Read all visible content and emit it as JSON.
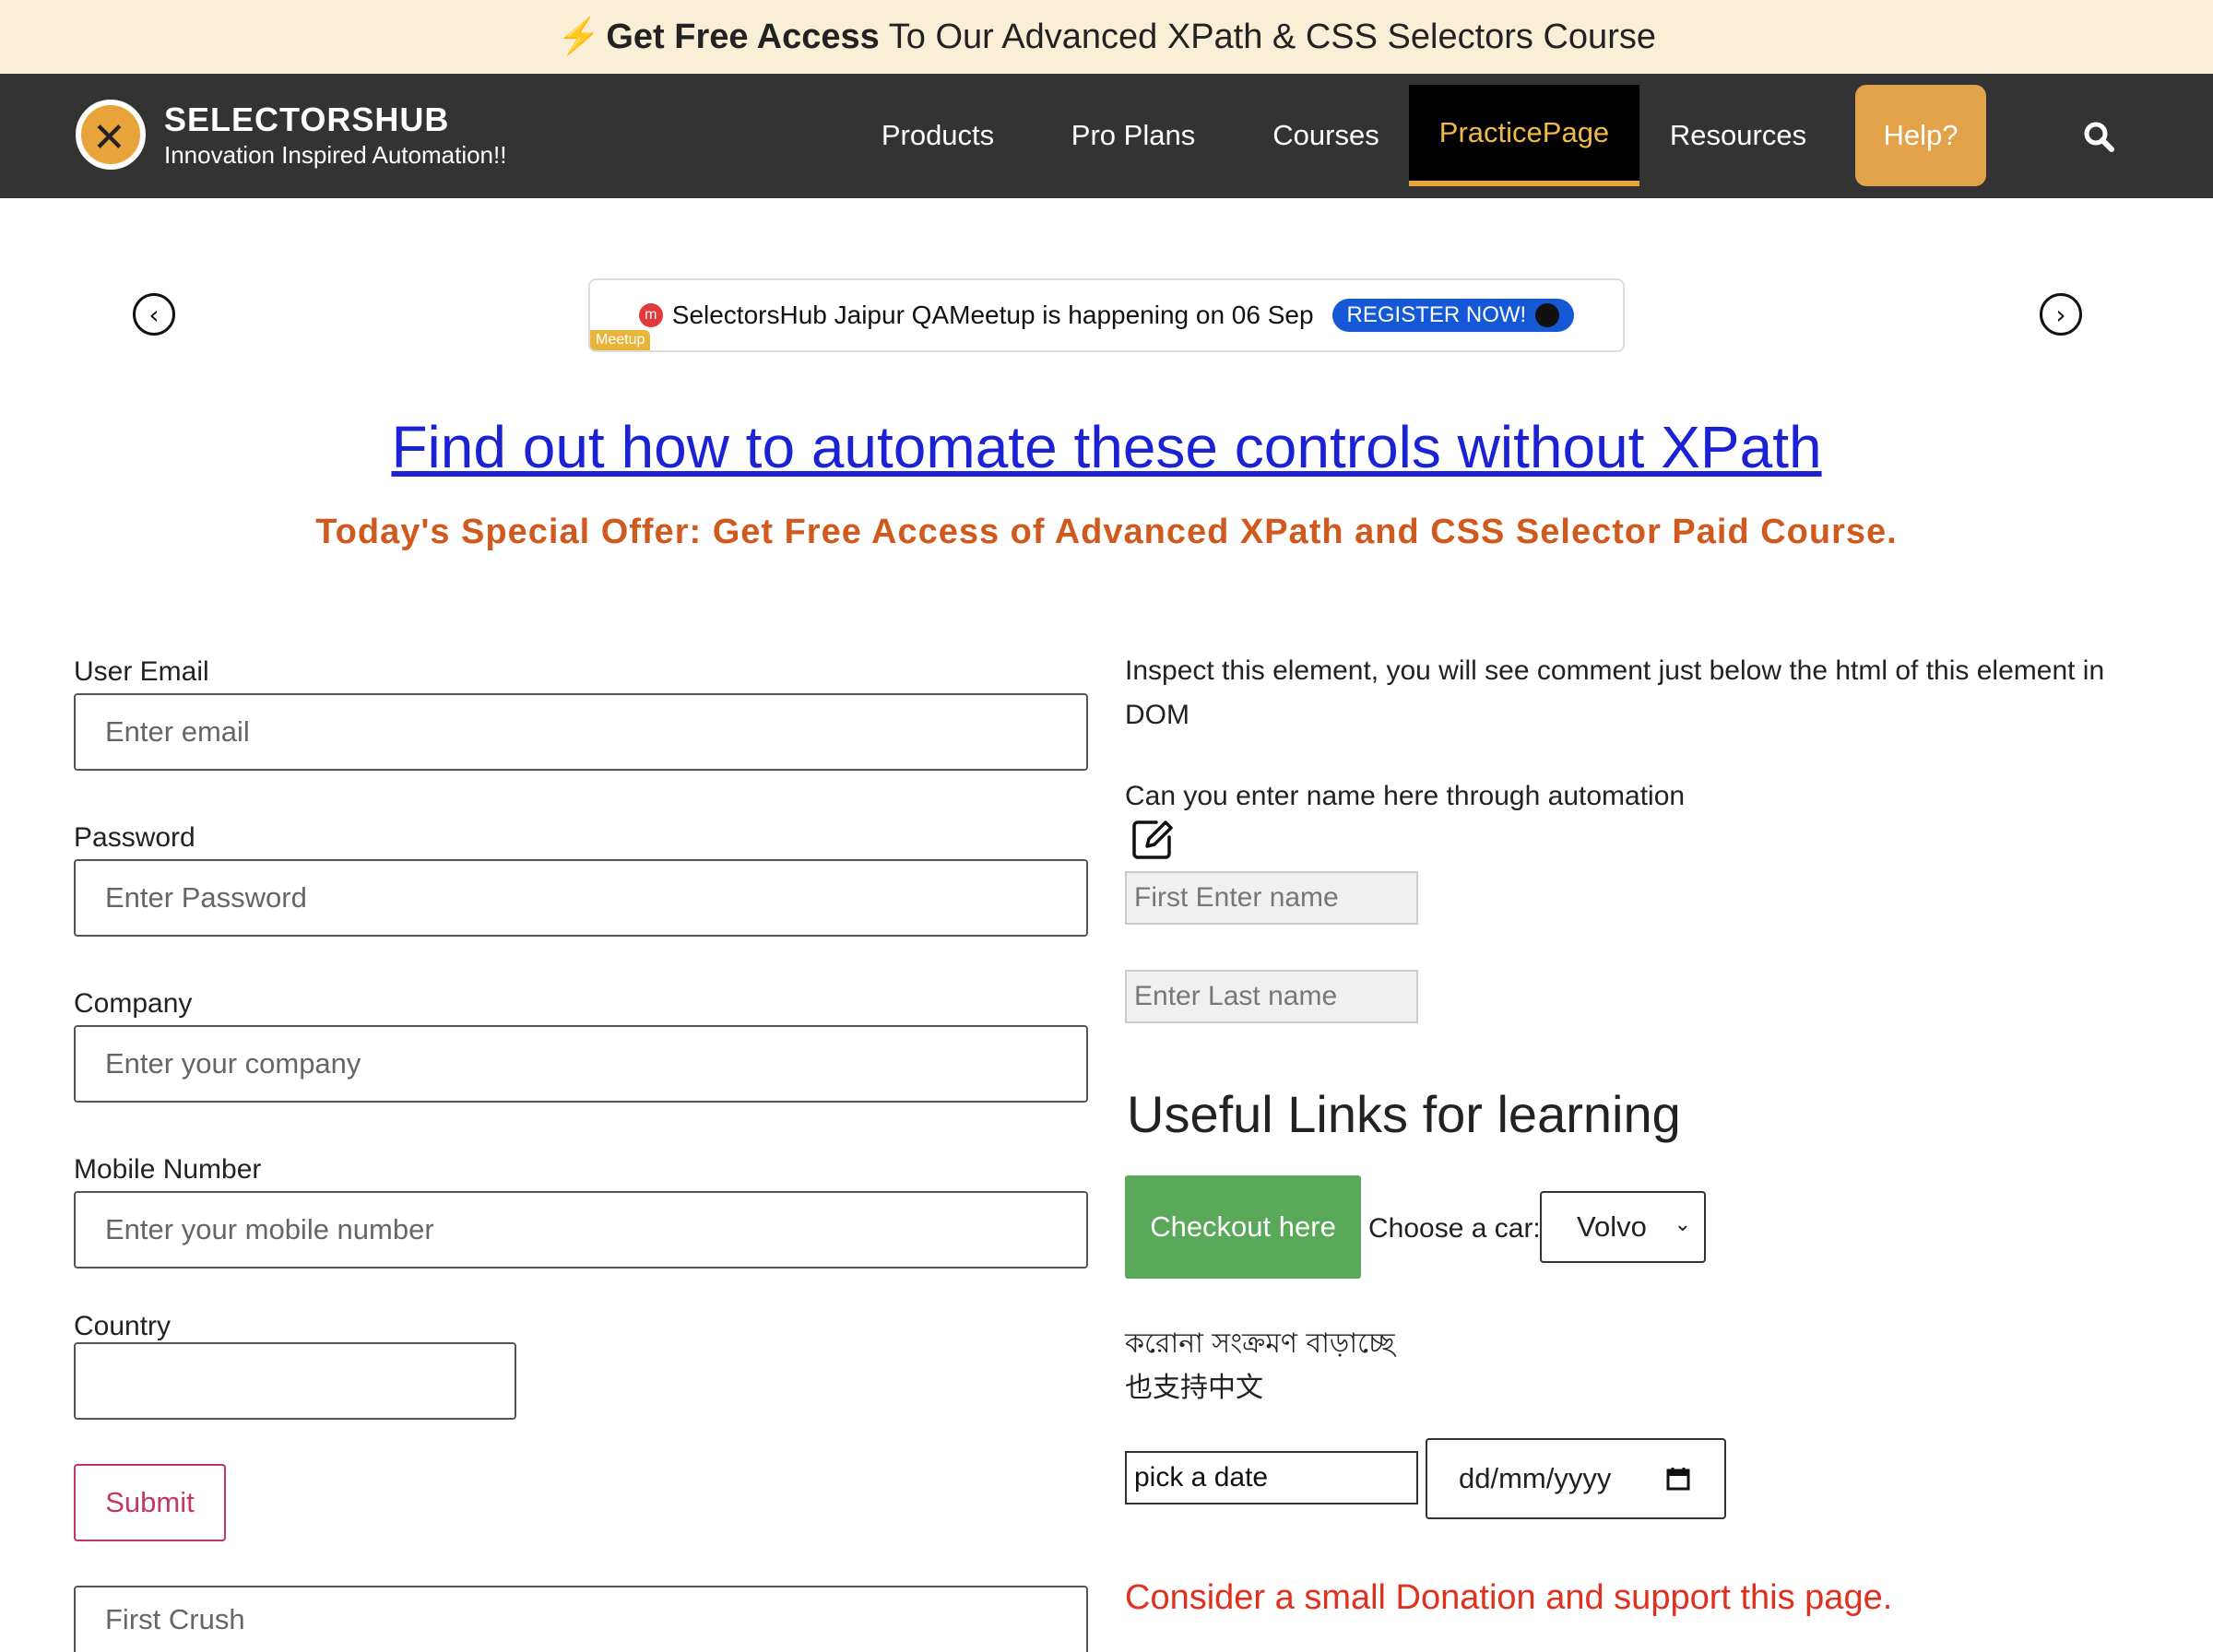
{
  "promo": {
    "strong": "Get Free Access",
    "rest": "To Our Advanced XPath & CSS Selectors Course"
  },
  "brand": {
    "name": "SELECTORSHUB",
    "tagline": "Innovation Inspired Automation!!"
  },
  "nav": {
    "items": [
      {
        "label": "Products"
      },
      {
        "label": "Pro Plans"
      },
      {
        "label": "Courses"
      },
      {
        "label": "PracticePage"
      },
      {
        "label": "Resources"
      },
      {
        "label": "Help?"
      }
    ]
  },
  "banner": {
    "tag": "Meetup",
    "text": "SelectorsHub Jaipur QAMeetup is happening on 06 Sep",
    "button": "REGISTER NOW!"
  },
  "headline": "Find out how to automate these controls without XPath",
  "offer": "Today's Special Offer: Get Free Access of Advanced XPath and CSS Selector Paid Course.",
  "form": {
    "email": {
      "label": "User Email",
      "placeholder": "Enter email"
    },
    "password": {
      "label": "Password",
      "placeholder": "Enter Password"
    },
    "company": {
      "label": "Company",
      "placeholder": "Enter your company"
    },
    "mobile": {
      "label": "Mobile Number",
      "placeholder": "Enter your mobile number"
    },
    "country": {
      "label": "Country",
      "value": ""
    },
    "submit": "Submit",
    "first_crush": {
      "placeholder": "First Crush"
    }
  },
  "right": {
    "inspect_text": "Inspect this element, you will see comment just below the html of this element in DOM",
    "name_prompt": "Can you enter name here through automation",
    "first_name_placeholder": "First Enter name",
    "last_name_placeholder": "Enter Last name",
    "useful_links": "Useful Links for learning",
    "checkout": "Checkout here",
    "car_label": "Choose a car:",
    "car_selected": "Volvo",
    "bengali": "করোনা সংক্রমণ বাড়াচ্ছে",
    "chinese": "也支持中文",
    "date_text_value": "pick a date",
    "date_picker_placeholder": "dd/mm/yyyy",
    "donation": "Consider a small Donation and support this page."
  },
  "colors": {
    "promo_bg": "#f9efd6",
    "nav_bg": "#333333",
    "accent": "#e8a33a",
    "headline": "#1a22d4",
    "offer": "#d05a1e",
    "checkout_bg": "#5aa85a",
    "donation": "#e0301e",
    "submit": "#c4375f"
  },
  "icons": [
    "lightning-icon",
    "logo-x-icon",
    "search-icon",
    "chevron-left-icon",
    "chevron-right-icon",
    "meetup-icon",
    "cursor-icon",
    "edit-icon",
    "chevron-down-icon",
    "calendar-icon"
  ]
}
